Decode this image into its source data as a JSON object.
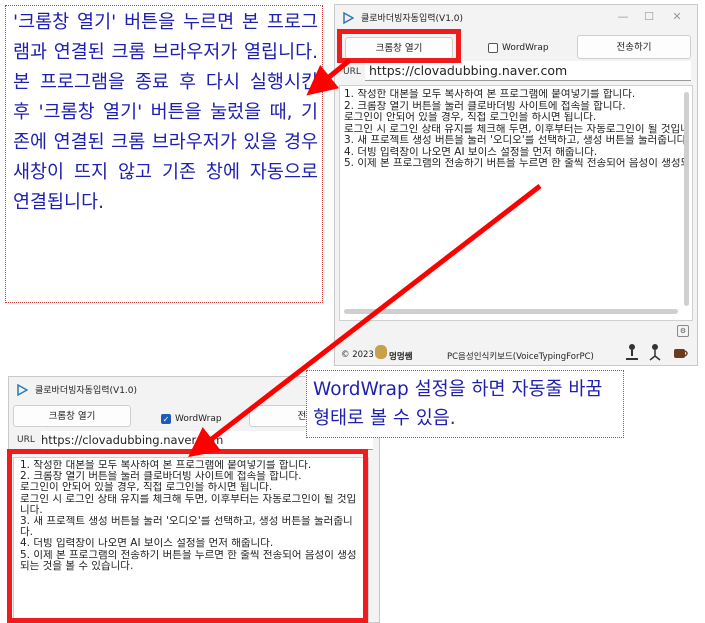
{
  "callout_top": {
    "text": "'크롬창 열기' 버튼을 누르면 본 프로그램과 연결된 크롬 브라우저가 열립니다. 본 프로그램을 종료 후 다시 실행시킨 후 '크롬창 열기' 버튼을 눌렀을 때, 기존에 연결된 크롬 브라우저가 있을 경우 새창이 뜨지 않고 기존 창에 자동으로 연결됩니다."
  },
  "callout_bottom": {
    "text": "WordWrap 설정을 하면 자동줄 바꿈 형태로 볼 수 있음."
  },
  "app": {
    "title": "클로바더빙자동입력(V1.0)",
    "open_chrome_label": "크롬창 열기",
    "wordwrap_label": "WordWrap",
    "send_label": "전송하기",
    "url_label": "URL",
    "url_value": "https://clovadubbing.naver.com",
    "instructions": [
      "1. 작성한 대본을 모두 복사하여 본 프로그램에 붙여넣기를 합니다.",
      "2. 크롬창 열기 버튼을 눌러 클로바더빙 사이트에 접속을 합니다.",
      "로그인이 안되어 있을 경우, 직접 로그인을 하시면 됩니다.",
      "로그인 시 로그인 상태 유지를 체크해 두면, 이후부터는 자동로그인이 될 것입니다.",
      "3. 새 프로젝트 생성 버튼을 눌러 '오디오'를 선택하고, 생성 버튼을 눌러줍니다.",
      "4. 더빙 입력창이 나오면 AI 보이스 설정을 먼저 해줍니다.",
      "5. 이제 본 프로그램의 전송하기 버튼을 누르면 한 줄씩 전송되어 음성이 생성되는 것을 볼 수 있습니다."
    ],
    "footer_copyright": "© 2023",
    "footer_brand": "멍멍쌤",
    "footer_program": "PC음성인식키보드(VoiceTypingForPC)"
  },
  "colors": {
    "callout_text": "#1f1fb0",
    "highlight_red": "#ee1c1c",
    "arrow_red": "#ff0000",
    "checkbox_checked": "#1b5bbd"
  }
}
